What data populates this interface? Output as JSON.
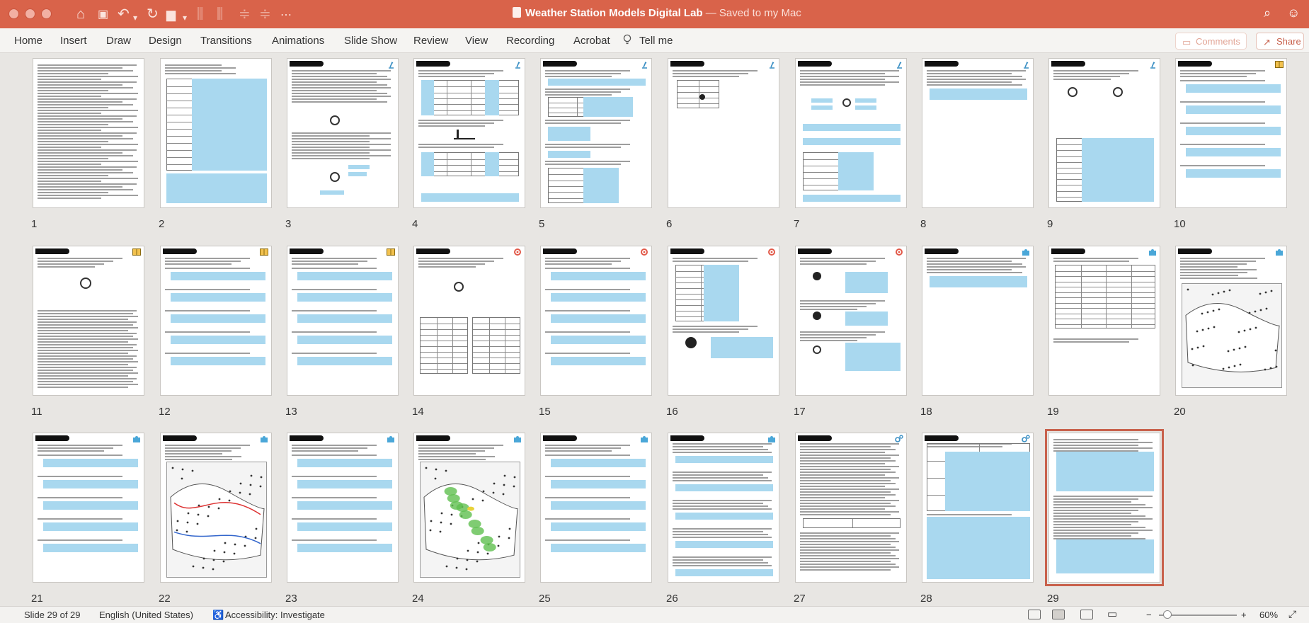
{
  "window": {
    "title": "Weather Station Models Digital Lab",
    "status": " — Saved to my Mac"
  },
  "ribbon": {
    "tabs": [
      "Home",
      "Insert",
      "Draw",
      "Design",
      "Transitions",
      "Animations",
      "Slide Show",
      "Review",
      "View",
      "Recording",
      "Acrobat"
    ],
    "tell_me": "Tell me",
    "comments": "Comments",
    "share": "Share"
  },
  "slides": [
    {
      "number": "1",
      "kind": "text"
    },
    {
      "number": "2",
      "kind": "form"
    },
    {
      "number": "3",
      "kind": "station",
      "icon": "microscope"
    },
    {
      "number": "4",
      "kind": "table",
      "icon": "microscope"
    },
    {
      "number": "5",
      "kind": "qa",
      "icon": "microscope"
    },
    {
      "number": "6",
      "kind": "smalltable",
      "icon": "microscope"
    },
    {
      "number": "7",
      "kind": "station2",
      "icon": "microscope"
    },
    {
      "number": "8",
      "kind": "short",
      "icon": "microscope"
    },
    {
      "number": "9",
      "kind": "grid",
      "icon": "microscope"
    },
    {
      "number": "10",
      "kind": "questions",
      "icon": "book"
    },
    {
      "number": "11",
      "kind": "reading",
      "icon": "book"
    },
    {
      "number": "12",
      "kind": "questions",
      "icon": "book"
    },
    {
      "number": "13",
      "kind": "questions",
      "icon": "book"
    },
    {
      "number": "14",
      "kind": "assess",
      "icon": "target"
    },
    {
      "number": "15",
      "kind": "questions",
      "icon": "target"
    },
    {
      "number": "16",
      "kind": "assesstable",
      "icon": "target"
    },
    {
      "number": "17",
      "kind": "assess2",
      "icon": "target"
    },
    {
      "number": "18",
      "kind": "short",
      "icon": "puzzle"
    },
    {
      "number": "19",
      "kind": "grid2",
      "icon": "puzzle"
    },
    {
      "number": "20",
      "kind": "mapbw",
      "icon": "puzzle"
    },
    {
      "number": "21",
      "kind": "questions",
      "icon": "puzzle"
    },
    {
      "number": "22",
      "kind": "mapred",
      "icon": "puzzle"
    },
    {
      "number": "23",
      "kind": "questions",
      "icon": "puzzle"
    },
    {
      "number": "24",
      "kind": "mapgreen",
      "icon": "puzzle"
    },
    {
      "number": "25",
      "kind": "questions",
      "icon": "puzzle"
    },
    {
      "number": "26",
      "kind": "longtext",
      "icon": "puzzle"
    },
    {
      "number": "27",
      "kind": "longtext2",
      "icon": "gears"
    },
    {
      "number": "28",
      "kind": "leftgrid",
      "icon": "gears"
    },
    {
      "number": "29",
      "kind": "final"
    }
  ],
  "statusbar": {
    "slide_info": "Slide 29 of 29",
    "language": "English (United States)",
    "accessibility": "Accessibility: Investigate",
    "zoom": "60%"
  },
  "colors": {
    "accent": "#d9634a",
    "answer_box": "#a9d8ef"
  }
}
